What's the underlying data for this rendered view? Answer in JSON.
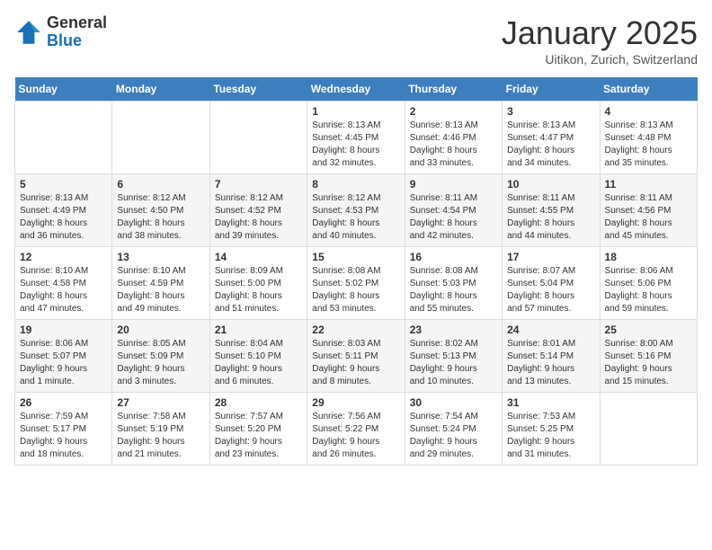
{
  "header": {
    "logo": {
      "general": "General",
      "blue": "Blue"
    },
    "title": "January 2025",
    "subtitle": "Uitikon, Zurich, Switzerland"
  },
  "calendar": {
    "days_of_week": [
      "Sunday",
      "Monday",
      "Tuesday",
      "Wednesday",
      "Thursday",
      "Friday",
      "Saturday"
    ],
    "weeks": [
      [
        {
          "day": "",
          "info": ""
        },
        {
          "day": "",
          "info": ""
        },
        {
          "day": "",
          "info": ""
        },
        {
          "day": "1",
          "info": "Sunrise: 8:13 AM\nSunset: 4:45 PM\nDaylight: 8 hours\nand 32 minutes."
        },
        {
          "day": "2",
          "info": "Sunrise: 8:13 AM\nSunset: 4:46 PM\nDaylight: 8 hours\nand 33 minutes."
        },
        {
          "day": "3",
          "info": "Sunrise: 8:13 AM\nSunset: 4:47 PM\nDaylight: 8 hours\nand 34 minutes."
        },
        {
          "day": "4",
          "info": "Sunrise: 8:13 AM\nSunset: 4:48 PM\nDaylight: 8 hours\nand 35 minutes."
        }
      ],
      [
        {
          "day": "5",
          "info": "Sunrise: 8:13 AM\nSunset: 4:49 PM\nDaylight: 8 hours\nand 36 minutes."
        },
        {
          "day": "6",
          "info": "Sunrise: 8:12 AM\nSunset: 4:50 PM\nDaylight: 8 hours\nand 38 minutes."
        },
        {
          "day": "7",
          "info": "Sunrise: 8:12 AM\nSunset: 4:52 PM\nDaylight: 8 hours\nand 39 minutes."
        },
        {
          "day": "8",
          "info": "Sunrise: 8:12 AM\nSunset: 4:53 PM\nDaylight: 8 hours\nand 40 minutes."
        },
        {
          "day": "9",
          "info": "Sunrise: 8:11 AM\nSunset: 4:54 PM\nDaylight: 8 hours\nand 42 minutes."
        },
        {
          "day": "10",
          "info": "Sunrise: 8:11 AM\nSunset: 4:55 PM\nDaylight: 8 hours\nand 44 minutes."
        },
        {
          "day": "11",
          "info": "Sunrise: 8:11 AM\nSunset: 4:56 PM\nDaylight: 8 hours\nand 45 minutes."
        }
      ],
      [
        {
          "day": "12",
          "info": "Sunrise: 8:10 AM\nSunset: 4:58 PM\nDaylight: 8 hours\nand 47 minutes."
        },
        {
          "day": "13",
          "info": "Sunrise: 8:10 AM\nSunset: 4:59 PM\nDaylight: 8 hours\nand 49 minutes."
        },
        {
          "day": "14",
          "info": "Sunrise: 8:09 AM\nSunset: 5:00 PM\nDaylight: 8 hours\nand 51 minutes."
        },
        {
          "day": "15",
          "info": "Sunrise: 8:08 AM\nSunset: 5:02 PM\nDaylight: 8 hours\nand 53 minutes."
        },
        {
          "day": "16",
          "info": "Sunrise: 8:08 AM\nSunset: 5:03 PM\nDaylight: 8 hours\nand 55 minutes."
        },
        {
          "day": "17",
          "info": "Sunrise: 8:07 AM\nSunset: 5:04 PM\nDaylight: 8 hours\nand 57 minutes."
        },
        {
          "day": "18",
          "info": "Sunrise: 8:06 AM\nSunset: 5:06 PM\nDaylight: 8 hours\nand 59 minutes."
        }
      ],
      [
        {
          "day": "19",
          "info": "Sunrise: 8:06 AM\nSunset: 5:07 PM\nDaylight: 9 hours\nand 1 minute."
        },
        {
          "day": "20",
          "info": "Sunrise: 8:05 AM\nSunset: 5:09 PM\nDaylight: 9 hours\nand 3 minutes."
        },
        {
          "day": "21",
          "info": "Sunrise: 8:04 AM\nSunset: 5:10 PM\nDaylight: 9 hours\nand 6 minutes."
        },
        {
          "day": "22",
          "info": "Sunrise: 8:03 AM\nSunset: 5:11 PM\nDaylight: 9 hours\nand 8 minutes."
        },
        {
          "day": "23",
          "info": "Sunrise: 8:02 AM\nSunset: 5:13 PM\nDaylight: 9 hours\nand 10 minutes."
        },
        {
          "day": "24",
          "info": "Sunrise: 8:01 AM\nSunset: 5:14 PM\nDaylight: 9 hours\nand 13 minutes."
        },
        {
          "day": "25",
          "info": "Sunrise: 8:00 AM\nSunset: 5:16 PM\nDaylight: 9 hours\nand 15 minutes."
        }
      ],
      [
        {
          "day": "26",
          "info": "Sunrise: 7:59 AM\nSunset: 5:17 PM\nDaylight: 9 hours\nand 18 minutes."
        },
        {
          "day": "27",
          "info": "Sunrise: 7:58 AM\nSunset: 5:19 PM\nDaylight: 9 hours\nand 21 minutes."
        },
        {
          "day": "28",
          "info": "Sunrise: 7:57 AM\nSunset: 5:20 PM\nDaylight: 9 hours\nand 23 minutes."
        },
        {
          "day": "29",
          "info": "Sunrise: 7:56 AM\nSunset: 5:22 PM\nDaylight: 9 hours\nand 26 minutes."
        },
        {
          "day": "30",
          "info": "Sunrise: 7:54 AM\nSunset: 5:24 PM\nDaylight: 9 hours\nand 29 minutes."
        },
        {
          "day": "31",
          "info": "Sunrise: 7:53 AM\nSunset: 5:25 PM\nDaylight: 9 hours\nand 31 minutes."
        },
        {
          "day": "",
          "info": ""
        }
      ]
    ]
  }
}
